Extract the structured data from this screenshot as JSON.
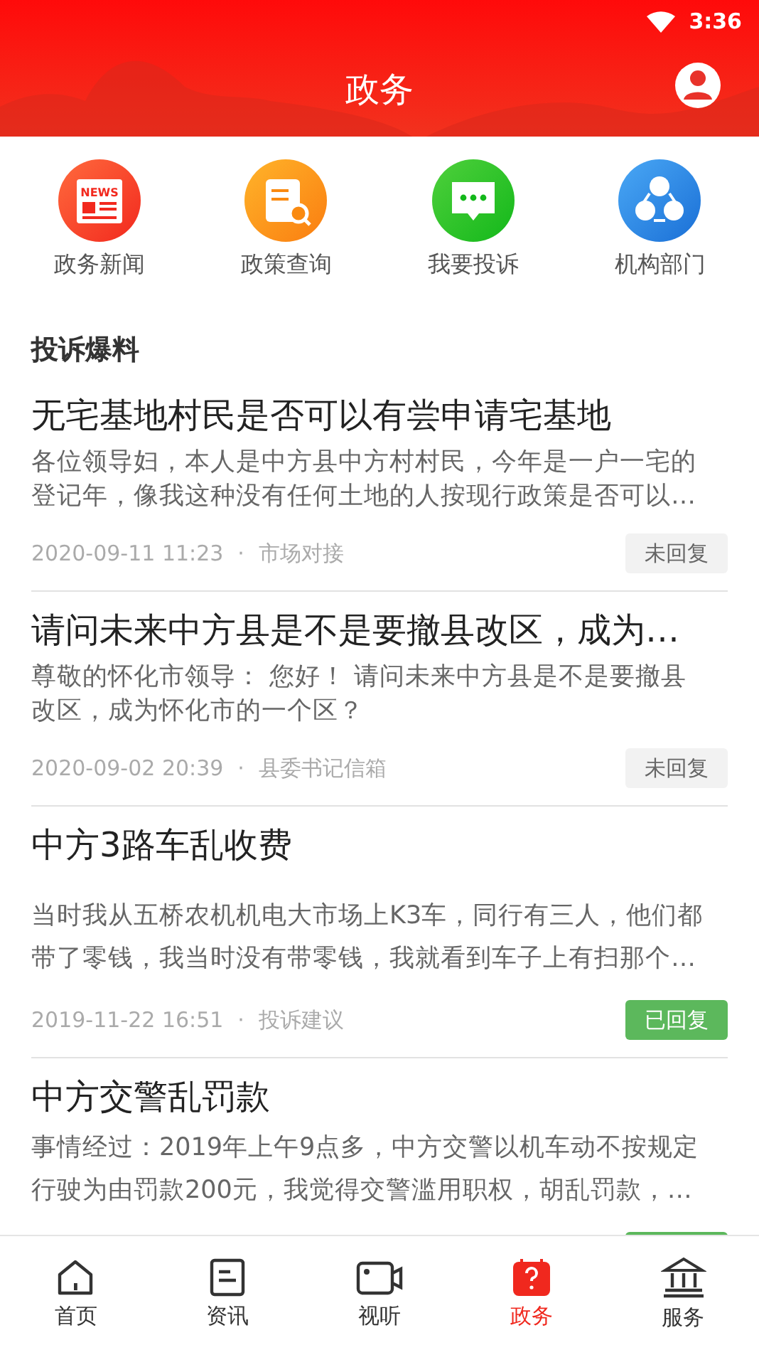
{
  "status_bar": {
    "time": "3:36"
  },
  "header": {
    "title": "政务"
  },
  "shortcuts": [
    {
      "kind": "news",
      "label": "政务新闻",
      "icon_text": "NEWS"
    },
    {
      "kind": "policy",
      "label": "政策查询"
    },
    {
      "kind": "complaint",
      "label": "我要投诉"
    },
    {
      "kind": "org",
      "label": "机构部门"
    }
  ],
  "section_title": "投诉爆料",
  "posts": [
    {
      "title": "无宅基地村民是否可以有尝申请宅基地",
      "body": [
        "各位领导妇，本人是中方县中方村村民，今年是一户一宅的",
        "登记年，像我这种没有任何土地的人按现行政策是否可以…"
      ],
      "date": "2020-09-11 11:23",
      "separator": "·",
      "category": "市场对接",
      "replied": false,
      "badge": "未回复"
    },
    {
      "title": "请问未来中方县是不是要撤县改区，成为…",
      "body": [
        "尊敬的怀化市领导：  您好！  请问未来中方县是不是要撤县",
        "改区，成为怀化市的一个区？"
      ],
      "date": "2020-09-02 20:39",
      "separator": "·",
      "category": "县委书记信箱",
      "replied": false,
      "badge": "未回复"
    },
    {
      "title": "中方3路车乱收费",
      "body": [
        "当时我从五桥农机机电大市场上K3车，同行有三人，他们都",
        "带了零钱，我当时没有带零钱，我就看到车子上有扫那个…"
      ],
      "date": "2019-11-22 16:51",
      "separator": "·",
      "category": "投诉建议",
      "replied": true,
      "badge": "已回复"
    },
    {
      "title": "中方交警乱罚款",
      "body": [
        "事情经过：2019年上午9点多，中方交警以机车动不按规定",
        "行驶为由罚款200元，我觉得交警滥用职权，胡乱罚款，…"
      ],
      "replied": true
    }
  ],
  "tabs": [
    {
      "kind": "home",
      "label": "首页",
      "selected": false
    },
    {
      "kind": "news",
      "label": "资讯",
      "selected": false
    },
    {
      "kind": "video",
      "label": "视听",
      "selected": false
    },
    {
      "kind": "gov",
      "label": "政务",
      "selected": true
    },
    {
      "kind": "service",
      "label": "服务",
      "selected": false
    }
  ]
}
